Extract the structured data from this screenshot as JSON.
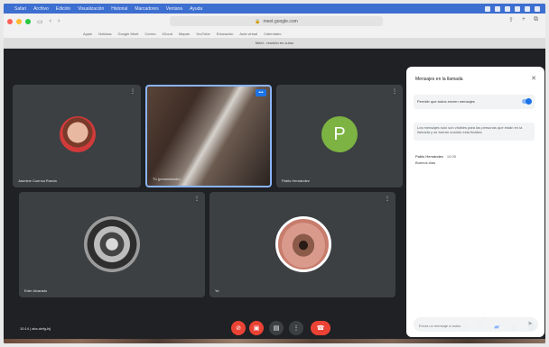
{
  "menubar": {
    "items": [
      "Safari",
      "Archivo",
      "Edición",
      "Visualización",
      "Historial",
      "Marcadores",
      "Ventana",
      "Ayuda"
    ],
    "clock": "(sin datos)"
  },
  "browser": {
    "url": "meet.google.com",
    "bookmarks": [
      "Apple",
      "Noticias",
      "Google Meet",
      "Correo",
      "iCloud",
      "Mapas",
      "YouTube",
      "Educación",
      "Aula virtual",
      "Calendario"
    ],
    "tab_title": "Meet - reunión en curso"
  },
  "participants": [
    {
      "name": "Jasmine Cuenca Rueda"
    },
    {
      "name": "Tú (presentando)",
      "active": true
    },
    {
      "name": "Pablo Hernández",
      "initial": "P"
    },
    {
      "name": "Eder Alvarado"
    },
    {
      "name": "Yo"
    }
  ],
  "panel": {
    "title": "Mensajes en la llamada",
    "setting_label": "Permitir que todos envíen mensajes",
    "notice": "Los mensajes solo son visibles para las personas que están en la llamada y se borran cuando esta finaliza",
    "message": {
      "author": "Pablo Hernández",
      "time": "10:05",
      "text": "Buenos días"
    },
    "composer_placeholder": "Envía un mensaje a todos"
  },
  "controls": {
    "meeting_time": "10:14 | abc-defg-hij",
    "participant_count": "5"
  },
  "colors": {
    "meet_bg": "#202124",
    "tile_bg": "#3c4043",
    "accent": "#1a73e8",
    "danger": "#ea4335",
    "avatar_green": "#7cb342"
  }
}
